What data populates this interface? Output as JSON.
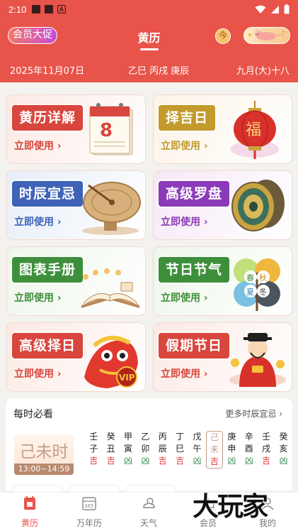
{
  "status_bar": {
    "time": "2:10",
    "icons": [
      "notification-square-icon",
      "notification-square-icon",
      "app-a-icon",
      "wifi-icon",
      "signal-icon",
      "battery-icon"
    ]
  },
  "header": {
    "promo_label": "会员大促",
    "title": "黄历",
    "today_label": "今",
    "vip_icon": "zodiac-rat-icon"
  },
  "date_bar": {
    "solar_date": "2025年11月07日",
    "ganzhi": "乙巳 丙戌 庚辰",
    "lunar_date": "九月(大)十八"
  },
  "cards": [
    {
      "title": "黄历详解",
      "action": "立即使用",
      "icon": "desk-calendar-icon",
      "calendar_day": "8",
      "badge_color": "#d8463d",
      "bg": "#fbe9e3"
    },
    {
      "title": "择吉日",
      "action": "立即使用",
      "icon": "fu-lantern-icon",
      "lantern_text": "福",
      "badge_color": "#c39a2c",
      "bg": "#fdf3e7"
    },
    {
      "title": "时辰宜忌",
      "action": "立即使用",
      "icon": "sundial-icon",
      "badge_color": "#3f63b7",
      "bg": "#e6eef8"
    },
    {
      "title": "高级罗盘",
      "action": "立即使用",
      "icon": "compass-luopan-icon",
      "badge_color": "#8b3bb8",
      "bg": "#f6e8f6"
    },
    {
      "title": "图表手册",
      "action": "立即使用",
      "icon": "open-book-icon",
      "badge_color": "#3e8f3b",
      "bg": "#eef6ea"
    },
    {
      "title": "节日节气",
      "action": "立即使用",
      "icon": "four-seasons-tree-icon",
      "seasons": [
        "春",
        "秋",
        "夏",
        "冬"
      ],
      "badge_color": "#3e8f3b",
      "bg": "#eef6ea"
    },
    {
      "title": "高级择日",
      "action": "立即使用",
      "icon": "lion-dance-vip-icon",
      "vip_text": "VIP",
      "badge_color": "#d8463d",
      "bg": "#fbe9e3"
    },
    {
      "title": "假期节日",
      "action": "立即使用",
      "icon": "god-of-wealth-icon",
      "badge_color": "#d8463d",
      "bg": "#fbe9e3"
    }
  ],
  "hourly": {
    "title": "每时必看",
    "more_label": "更多时辰宜忌",
    "current_hour": "己未时",
    "current_range": "13:00~14:59",
    "hours": [
      {
        "stem": "壬",
        "branch": "子",
        "luck": "吉"
      },
      {
        "stem": "癸",
        "branch": "丑",
        "luck": "吉"
      },
      {
        "stem": "甲",
        "branch": "寅",
        "luck": "凶"
      },
      {
        "stem": "乙",
        "branch": "卯",
        "luck": "凶"
      },
      {
        "stem": "丙",
        "branch": "辰",
        "luck": "吉"
      },
      {
        "stem": "丁",
        "branch": "巳",
        "luck": "吉"
      },
      {
        "stem": "戊",
        "branch": "午",
        "luck": "凶"
      },
      {
        "stem": "己",
        "branch": "未",
        "luck": "吉",
        "current": true
      },
      {
        "stem": "庚",
        "branch": "申",
        "luck": "凶"
      },
      {
        "stem": "辛",
        "branch": "酉",
        "luck": "凶"
      },
      {
        "stem": "壬",
        "branch": "戌",
        "luck": "吉"
      },
      {
        "stem": "癸",
        "branch": "亥",
        "luck": "凶"
      }
    ]
  },
  "nav": [
    {
      "label": "黄历",
      "icon": "almanac-icon",
      "active": true
    },
    {
      "label": "万年历",
      "icon": "calendar-365-icon",
      "calendar_text": "365"
    },
    {
      "label": "天气",
      "icon": "weather-icon"
    },
    {
      "label": "会员",
      "icon": "crown-icon"
    },
    {
      "label": "我的",
      "icon": "profile-icon"
    }
  ],
  "watermark": "大玩家",
  "colors": {
    "primary": "#e8534a",
    "good": "#e23b3b",
    "bad": "#2e8b47",
    "hour_accent": "#c39d8a"
  }
}
